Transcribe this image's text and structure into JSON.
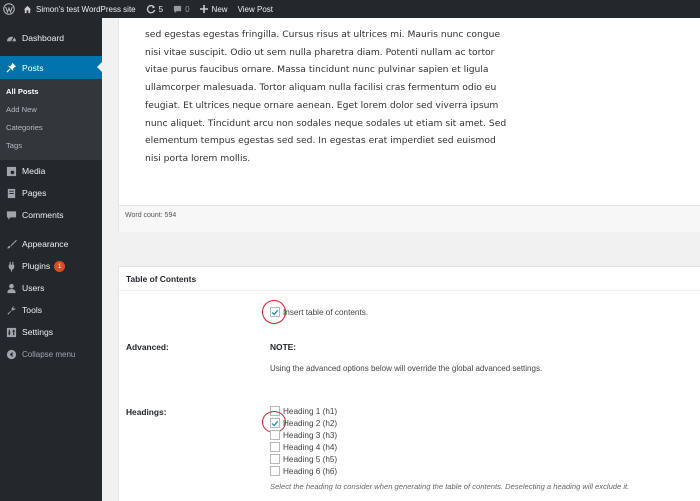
{
  "adminbar": {
    "site_name": "Simon's test WordPress site",
    "updates_count": "5",
    "comments_count": "0",
    "new_label": "New",
    "view_post_label": "View Post"
  },
  "sidebar": {
    "items": [
      {
        "label": "Dashboard",
        "icon": "dashboard-icon"
      },
      {
        "label": "Posts",
        "icon": "pin-icon"
      },
      {
        "label": "Media",
        "icon": "media-icon"
      },
      {
        "label": "Pages",
        "icon": "page-icon"
      },
      {
        "label": "Comments",
        "icon": "comment-icon"
      },
      {
        "label": "Appearance",
        "icon": "brush-icon"
      },
      {
        "label": "Plugins",
        "icon": "plug-icon",
        "badge": "1"
      },
      {
        "label": "Users",
        "icon": "user-icon"
      },
      {
        "label": "Tools",
        "icon": "wrench-icon"
      },
      {
        "label": "Settings",
        "icon": "settings-icon"
      }
    ],
    "posts_submenu": [
      "All Posts",
      "Add New",
      "Categories",
      "Tags"
    ],
    "collapse_label": "Collapse menu"
  },
  "editor": {
    "lines": [
      "sed egestas egestas fringilla. Cursus risus at ultrices mi. Mauris nunc congue",
      "nisi vitae suscipit. Odio ut sem nulla pharetra diam. Potenti nullam ac tortor",
      "vitae purus faucibus ornare. Massa tincidunt nunc pulvinar sapien et ligula",
      "ullamcorper malesuada. Tortor aliquam nulla facilisi cras fermentum odio eu",
      "feugiat. Et ultrices neque ornare aenean. Eget lorem dolor sed viverra ipsum",
      "nunc aliquet. Tincidunt arcu non sodales neque sodales ut etiam sit amet. Sed",
      "elementum tempus egestas sed sed. In egestas erat imperdiet sed euismod",
      "nisi porta lorem mollis."
    ],
    "word_count": "Word count: 594"
  },
  "toc": {
    "title": "Table of Contents",
    "insert_label": "Insert table of contents.",
    "insert_checked": true,
    "advanced_label": "Advanced:",
    "note_label": "NOTE:",
    "note_text": "Using the advanced options below will override the global advanced settings.",
    "headings_label": "Headings:",
    "headings": [
      {
        "label": "Heading 1 (h1)",
        "checked": false
      },
      {
        "label": "Heading 2 (h2)",
        "checked": true
      },
      {
        "label": "Heading 3 (h3)",
        "checked": false
      },
      {
        "label": "Heading 4 (h4)",
        "checked": false
      },
      {
        "label": "Heading 5 (h5)",
        "checked": false
      },
      {
        "label": "Heading 6 (h6)",
        "checked": false
      }
    ],
    "headings_description": "Select the heading to consider when generating the table of contents. Deselecting a heading will exclude it."
  },
  "colors": {
    "admin_dark": "#23282d",
    "accent_blue": "#0073aa",
    "highlight_circle": "#d0202a",
    "badge_orange": "#d54e21"
  }
}
